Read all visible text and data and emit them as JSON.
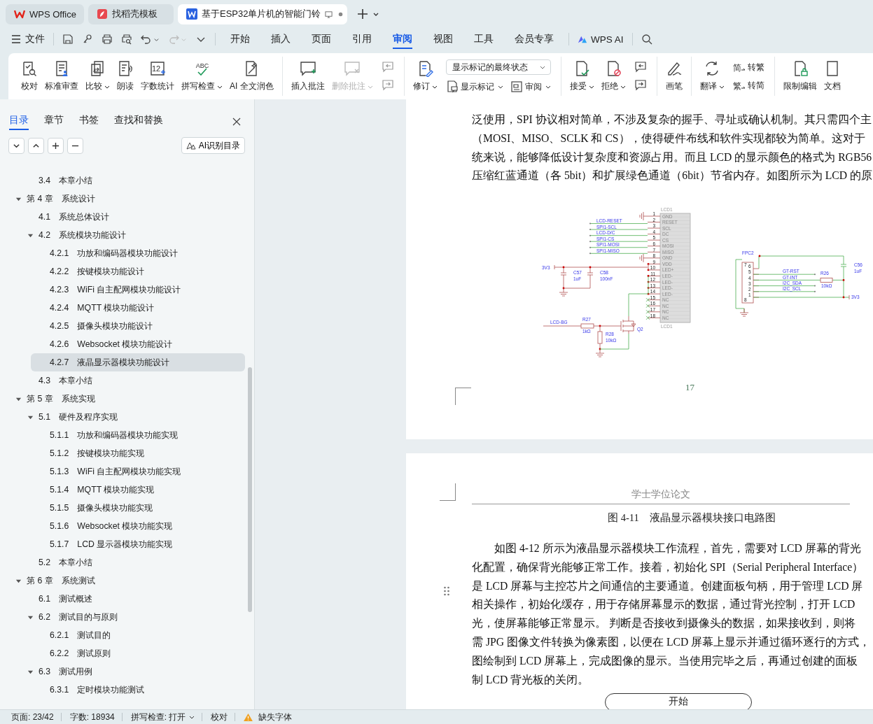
{
  "tabs": [
    {
      "label": "WPS Office",
      "kind": "home",
      "selected": false
    },
    {
      "label": "找稻壳模板",
      "kind": "template",
      "selected": false
    },
    {
      "label": "基于ESP32单片机的智能门铃",
      "kind": "doc",
      "selected": true
    }
  ],
  "menu": {
    "file": "文件",
    "items": [
      {
        "label": "开始",
        "selected": false
      },
      {
        "label": "插入",
        "selected": false
      },
      {
        "label": "页面",
        "selected": false
      },
      {
        "label": "引用",
        "selected": false
      },
      {
        "label": "审阅",
        "selected": true
      },
      {
        "label": "视图",
        "selected": false
      },
      {
        "label": "工具",
        "selected": false
      },
      {
        "label": "会员专享",
        "selected": false
      }
    ],
    "ai": "WPS AI"
  },
  "ribbon": {
    "groups": [
      {
        "items": [
          {
            "kind": "large",
            "label": "校对"
          },
          {
            "kind": "large",
            "label": "标准审查"
          },
          {
            "kind": "large",
            "label": "比较",
            "menu": true
          },
          {
            "kind": "large",
            "label": "朗读"
          },
          {
            "kind": "large",
            "label": "字数统计",
            "icon_text": "12"
          },
          {
            "kind": "large",
            "label": "拼写检查",
            "menu": true,
            "icon_text": "ABC"
          },
          {
            "kind": "large",
            "label": "AI 全文润色"
          }
        ]
      },
      {
        "items": [
          {
            "kind": "large",
            "label": "插入批注"
          },
          {
            "kind": "large",
            "label": "删除批注",
            "menu": true,
            "disabled": true
          },
          {
            "kind": "stack",
            "top": [
              {
                "kind": "icon",
                "disabled": true
              }
            ],
            "bottom": [
              {
                "kind": "icon",
                "disabled": true
              }
            ]
          }
        ]
      },
      {
        "items": [
          {
            "kind": "large",
            "label": "修订",
            "menu": true
          },
          {
            "kind": "stack",
            "top": [
              {
                "kind": "select",
                "value": "显示标记的最终状态"
              }
            ],
            "bottom": [
              {
                "kind": "small",
                "label": "显示标记",
                "menu": true
              },
              {
                "kind": "small",
                "label": "审阅",
                "menu": true
              }
            ]
          }
        ]
      },
      {
        "items": [
          {
            "kind": "large",
            "label": "接受",
            "menu": true
          },
          {
            "kind": "large",
            "label": "拒绝",
            "menu": true
          },
          {
            "kind": "stack",
            "top": [
              {
                "kind": "icon",
                "disabled": false
              }
            ],
            "bottom": [
              {
                "kind": "icon",
                "disabled": false
              }
            ]
          }
        ]
      },
      {
        "items": [
          {
            "kind": "large",
            "label": "画笔"
          }
        ]
      },
      {
        "items": [
          {
            "kind": "large",
            "label": "翻译",
            "menu": true
          },
          {
            "kind": "stack",
            "top": [
              {
                "kind": "small",
                "label": "转繁",
                "icon_text": "简"
              }
            ],
            "bottom": [
              {
                "kind": "small",
                "label": "转简",
                "icon_text": "繁"
              }
            ]
          }
        ]
      },
      {
        "items": [
          {
            "kind": "large",
            "label": "限制编辑"
          },
          {
            "kind": "large",
            "label": "文档"
          }
        ]
      }
    ]
  },
  "nav": {
    "tabs": [
      {
        "label": "目录",
        "selected": true
      },
      {
        "label": "章节",
        "selected": false
      },
      {
        "label": "书签",
        "selected": false
      },
      {
        "label": "查找和替换",
        "selected": false
      }
    ],
    "ai_button": "AI识别目录",
    "tree": [
      {
        "children": [
          {
            "number": "3.4",
            "title": "本章小结",
            "selected": false
          }
        ]
      },
      {
        "number": "第 4 章",
        "title": "系统设计",
        "selected": false,
        "expanded": true,
        "children": [
          {
            "number": "4.1",
            "title": "系统总体设计",
            "selected": false
          },
          {
            "number": "4.2",
            "title": "系统模块功能设计",
            "selected": false,
            "expanded": true,
            "children": [
              {
                "number": "4.2.1",
                "title": "功放和编码器模块功能设计",
                "selected": false
              },
              {
                "number": "4.2.2",
                "title": "按键模块功能设计",
                "selected": false
              },
              {
                "number": "4.2.3",
                "title": "WiFi 自主配网模块功能设计",
                "selected": false
              },
              {
                "number": "4.2.4",
                "title": "MQTT 模块功能设计",
                "selected": false
              },
              {
                "number": "4.2.5",
                "title": "摄像头模块功能设计",
                "selected": false
              },
              {
                "number": "4.2.6",
                "title": "Websocket 模块功能设计",
                "selected": false
              },
              {
                "number": "4.2.7",
                "title": "液晶显示器模块功能设计",
                "selected": true
              }
            ]
          },
          {
            "number": "4.3",
            "title": "本章小结",
            "selected": false
          }
        ]
      },
      {
        "number": "第 5 章",
        "title": "系统实现",
        "selected": false,
        "expanded": true,
        "children": [
          {
            "number": "5.1",
            "title": "硬件及程序实现",
            "selected": false,
            "expanded": true,
            "children": [
              {
                "number": "5.1.1",
                "title": "功放和编码器模块功能实现",
                "selected": false
              },
              {
                "number": "5.1.2",
                "title": "按键模块功能实现",
                "selected": false
              },
              {
                "number": "5.1.3",
                "title": "WiFi 自主配网模块功能实现",
                "selected": false
              },
              {
                "number": "5.1.4",
                "title": "MQTT 模块功能实现",
                "selected": false
              },
              {
                "number": "5.1.5",
                "title": "摄像头模块功能实现",
                "selected": false
              },
              {
                "number": "5.1.6",
                "title": "Websocket 模块功能实现",
                "selected": false
              },
              {
                "number": "5.1.7",
                "title": "LCD 显示器模块功能实现",
                "selected": false
              }
            ]
          },
          {
            "number": "5.2",
            "title": "本章小结",
            "selected": false
          }
        ]
      },
      {
        "number": "第 6 章",
        "title": "系统测试",
        "selected": false,
        "expanded": true,
        "children": [
          {
            "number": "6.1",
            "title": "测试概述",
            "selected": false
          },
          {
            "number": "6.2",
            "title": "测试目的与原则",
            "selected": false,
            "expanded": true,
            "children": [
              {
                "number": "6.2.1",
                "title": "测试目的",
                "selected": false
              },
              {
                "number": "6.2.2",
                "title": "测试原则",
                "selected": false
              }
            ]
          },
          {
            "number": "6.3",
            "title": "测试用例",
            "selected": false,
            "expanded": true,
            "children": [
              {
                "number": "6.3.1",
                "title": "定时模块功能测试",
                "selected": false
              }
            ]
          }
        ]
      }
    ]
  },
  "page1": {
    "lines": [
      "泛使用，SPI 协议相对简单，不涉及复杂的握手、寻址或确认机制。其只需四个主",
      "（MOSI、MISO、SCLK 和 CS），使得硬件布线和软件实现都较为简单。这对于",
      "统来说，能够降低设计复杂度和资源占用。而且 LCD 的显示颜色的格式为 RGB56",
      "压缩红蓝通道（各 5bit）和扩展绿色通道（6bit）节省内存。如图所示为 LCD 的原"
    ],
    "schematic": {
      "lcd": {
        "ref_top": "LCD1",
        "ref_bottom": "LCD1",
        "pins": [
          {
            "number": "1",
            "name": "GND",
            "kind": "ground"
          },
          {
            "number": "2",
            "name": "RESET",
            "kind": "signal",
            "net": "LCD-RESET"
          },
          {
            "number": "3",
            "name": "SCL",
            "kind": "signal",
            "net": "SPI1-SCL"
          },
          {
            "number": "4",
            "name": "DC",
            "kind": "signal",
            "net": "LCD-D/C"
          },
          {
            "number": "5",
            "name": "CS",
            "kind": "signal",
            "net": "SPI1-CS"
          },
          {
            "number": "6",
            "name": "MOSI",
            "kind": "signal",
            "net": "SPI1-MOSI"
          },
          {
            "number": "7",
            "name": "MISO",
            "kind": "signal",
            "net": "SPI1-MISO"
          },
          {
            "number": "8",
            "name": "GND",
            "kind": "ground"
          },
          {
            "number": "9",
            "name": "VDD",
            "kind": "supply"
          },
          {
            "number": "10",
            "name": "LED+",
            "kind": "supply"
          },
          {
            "number": "11",
            "name": "LED-",
            "kind": "backlight"
          },
          {
            "number": "12",
            "name": "LED-",
            "kind": "backlight"
          },
          {
            "number": "13",
            "name": "LED-",
            "kind": "backlight"
          },
          {
            "number": "14",
            "name": "LED-",
            "kind": "backlight"
          },
          {
            "number": "15",
            "name": "NC",
            "kind": "nc"
          },
          {
            "number": "16",
            "name": "NC",
            "kind": "nc"
          },
          {
            "number": "17",
            "name": "NC",
            "kind": "nc"
          },
          {
            "number": "18",
            "name": "NC",
            "kind": "nc"
          }
        ]
      },
      "parts": [
        {
          "ref": "C57",
          "value": "1uF"
        },
        {
          "ref": "C58",
          "value": "100nF"
        },
        {
          "ref": "R27",
          "value": "1kΩ"
        },
        {
          "ref": "R28",
          "value": "10kΩ"
        },
        {
          "ref": "Q2"
        },
        {
          "ref": "R26",
          "value": "10kΩ"
        },
        {
          "ref": "C56",
          "value": "1uF"
        }
      ],
      "nets": [
        "LCD-BG",
        "GT-RST",
        "GT-INT",
        "I2C_SDA",
        "I2C_SCL"
      ],
      "power": [
        "3V3",
        "3V3"
      ],
      "fpc": {
        "ref": "FPC2",
        "pins": [
          "7",
          "6",
          "5",
          "4",
          "3",
          "2",
          "1",
          "8"
        ]
      }
    },
    "page_number": "17"
  },
  "page2": {
    "header": "学士学位论文",
    "caption": "图 4-11　液晶显示器模块接口电路图",
    "lines": [
      "如图 4-12 所示为液晶显示器模块工作流程，首先，需要对 LCD 屏幕的背光",
      "化配置，确保背光能够正常工作。接着，初始化 SPI（Serial Peripheral Interface）",
      "是 LCD 屏幕与主控芯片之间通信的主要通道。创建面板句柄，用于管理 LCD 屏",
      "相关操作，初始化缓存，用于存储屏幕显示的数据，通过背光控制，打开 LCD",
      "光，使屏幕能够正常显示。 判断是否接收到摄像头的数据，如果接收到，则将",
      "需 JPG 图像文件转换为像素图，以便在 LCD 屏幕上显示并通过循环逐行的方式，",
      "图绘制到 LCD 屏幕上，完成图像的显示。当使用完毕之后，再通过创建的面板",
      "制 LCD 背光板的关闭。"
    ],
    "flow_start": "开始"
  },
  "status": {
    "items": [
      {
        "label": "页面: 23/42",
        "kind": "text"
      },
      {
        "label": "字数: 18934",
        "kind": "text"
      },
      {
        "label": "拼写检查: 打开",
        "kind": "menu"
      },
      {
        "label": "校对",
        "kind": "text"
      },
      {
        "label": "缺失字体",
        "kind": "warning"
      }
    ]
  }
}
